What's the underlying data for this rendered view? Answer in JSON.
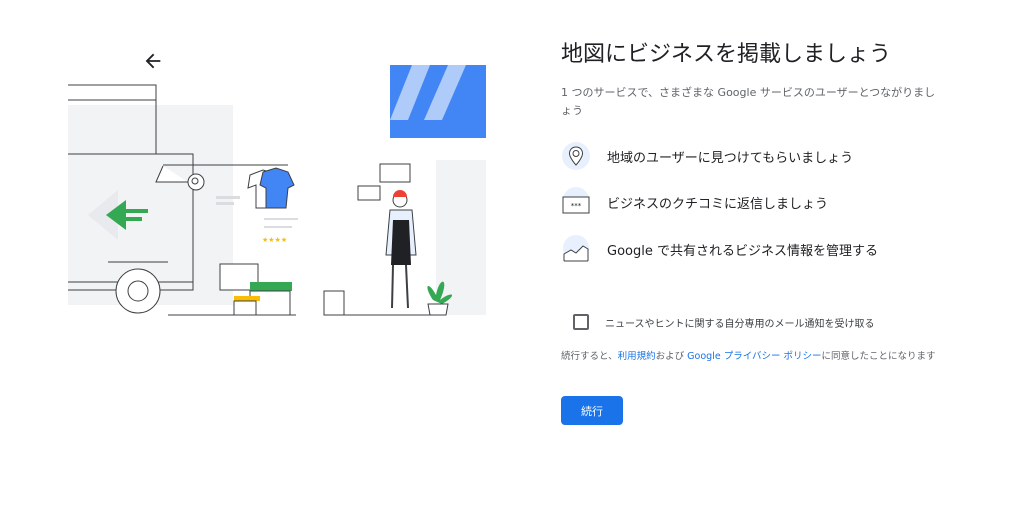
{
  "page": {
    "title": "地図にビジネスを掲載しましょう",
    "subtitle": "1 つのサービスで、さまざまな Google サービスのユーザーとつながりましょう"
  },
  "features": [
    {
      "icon": "map-pin-icon",
      "text": "地域のユーザーに見つけてもらいましょう"
    },
    {
      "icon": "review-stars-icon",
      "text": "ビジネスのクチコミに返信しましょう"
    },
    {
      "icon": "analytics-chart-icon",
      "text": "Google で共有されるビジネス情報を管理する"
    }
  ],
  "optin": {
    "label": "ニュースやヒントに関する自分専用のメール通知を受け取る",
    "checked": false
  },
  "terms": {
    "prefix": "続行すると、",
    "terms_link": "利用規約",
    "middle": "および ",
    "privacy_link": "Google プライバシー ポリシー",
    "suffix": "に同意したことになります"
  },
  "buttons": {
    "continue": "続行"
  },
  "colors": {
    "primary": "#1a73e8",
    "green": "#34a853",
    "yellow": "#fbbc04",
    "icon_bg": "#e8f0fe"
  }
}
